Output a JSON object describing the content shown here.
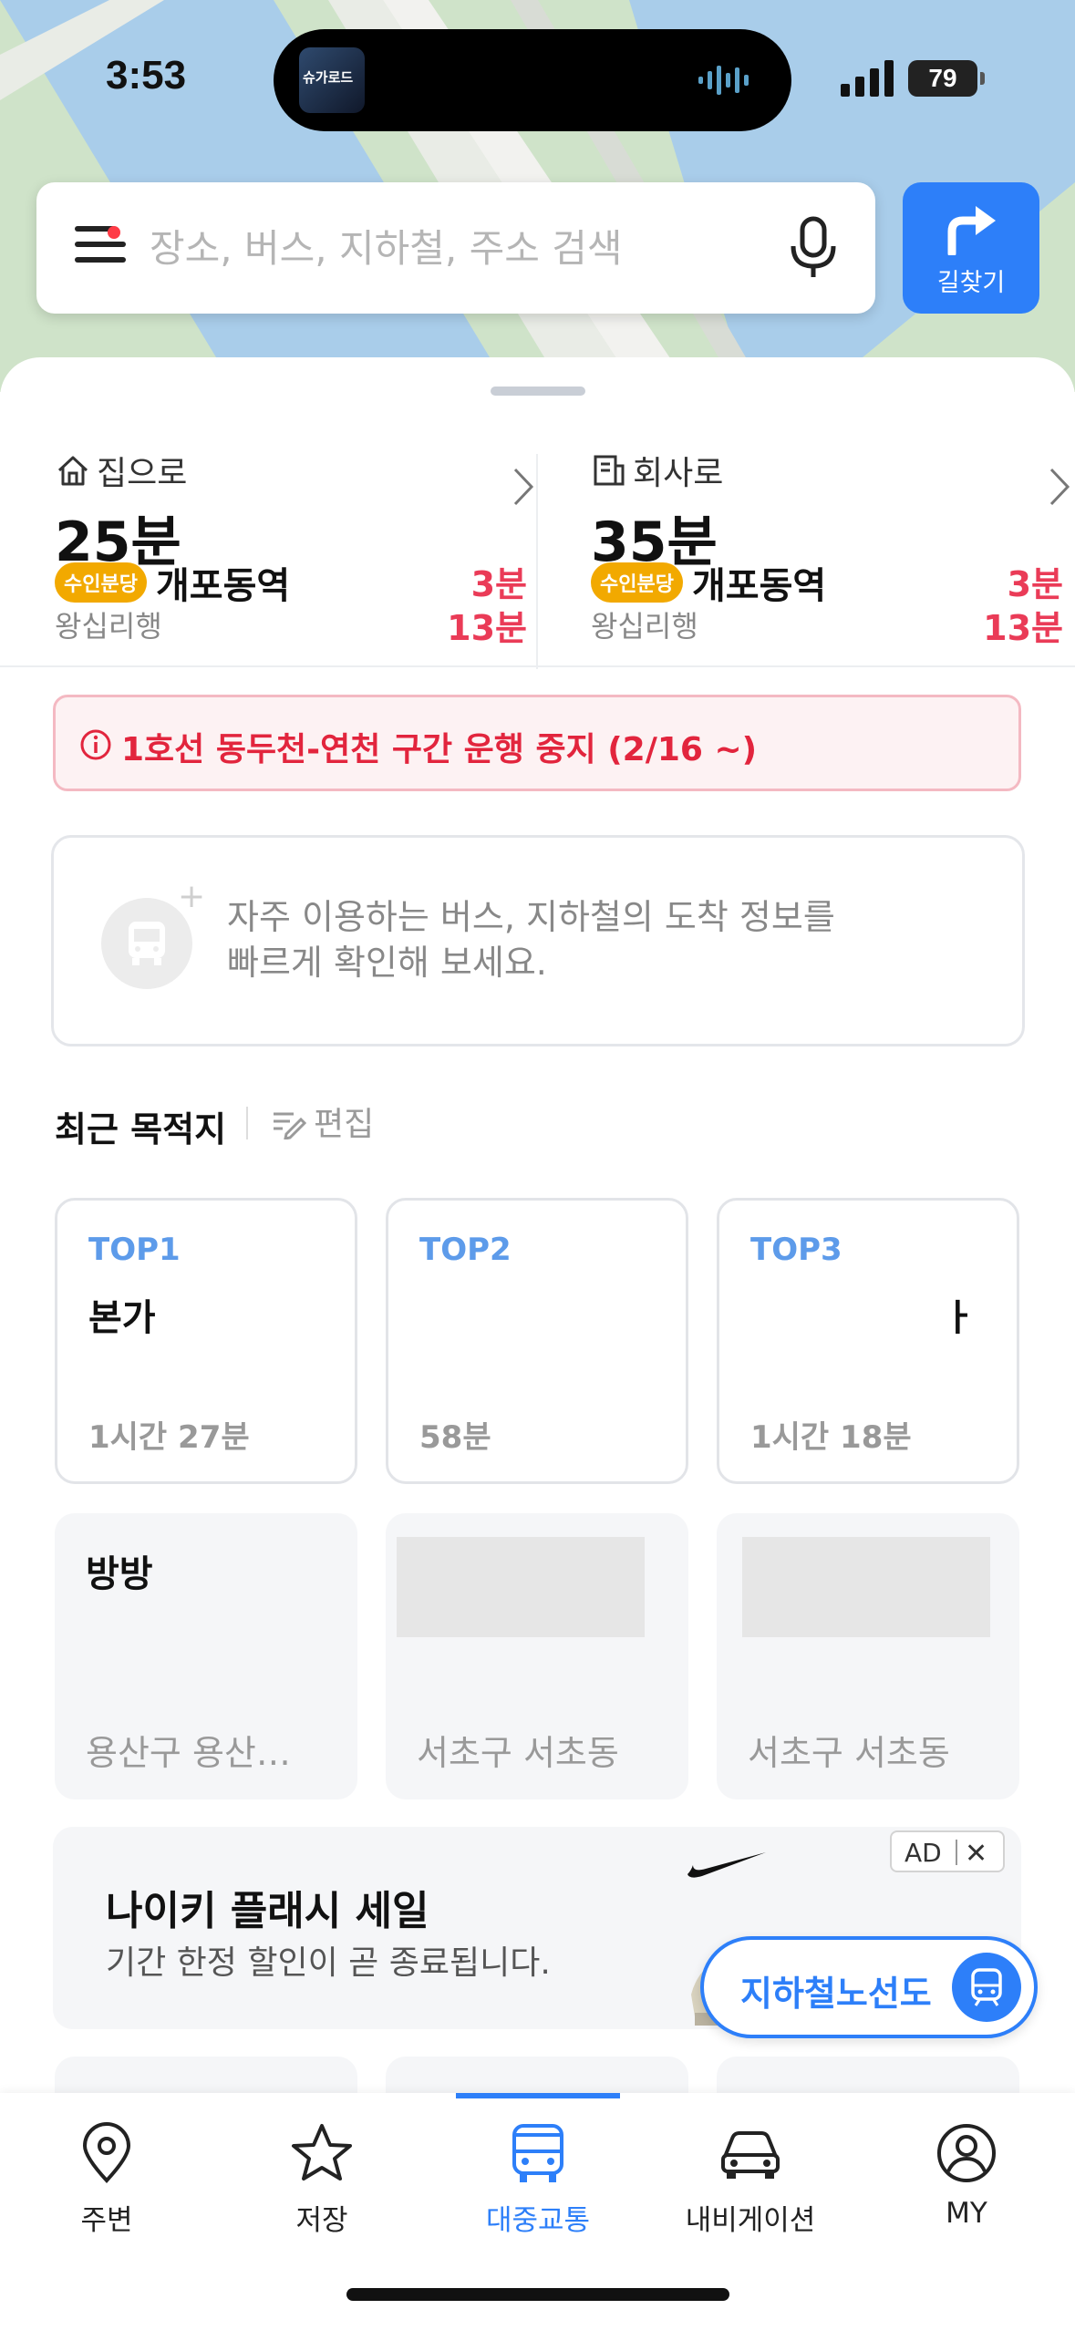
{
  "status_bar": {
    "time": "3:53",
    "battery": "79"
  },
  "search": {
    "placeholder": "장소, 버스, 지하철, 주소 검색"
  },
  "route_button": {
    "label": "길찾기"
  },
  "commute": {
    "home": {
      "label": "집으로",
      "time": "25분",
      "line_badge": "수인분당",
      "station": "개포동역",
      "direction": "왕십리행",
      "arrivals": [
        "3분",
        "13분"
      ]
    },
    "work": {
      "label": "회사로",
      "time": "35분",
      "line_badge": "수인분당",
      "station": "개포동역",
      "direction": "왕십리행",
      "arrivals": [
        "3분",
        "13분"
      ]
    }
  },
  "alert": {
    "text": "1호선 동두천-연천 구간 운행 중지 (2/16 ~)"
  },
  "favorites_prompt": {
    "line1": "자주 이용하는 버스, 지하철의 도착 정보를",
    "line2": "빠르게 확인해 보세요."
  },
  "recent": {
    "title": "최근 목적지",
    "edit_label": "편집",
    "top": [
      {
        "rank": "TOP1",
        "name": "본가",
        "time": "1시간 27분"
      },
      {
        "rank": "TOP2",
        "name": "",
        "time": "58분"
      },
      {
        "rank": "TOP3",
        "name": "ㅏ",
        "time": "1시간 18분"
      }
    ],
    "places": [
      {
        "name": "방방",
        "address": "용산구 용산…"
      },
      {
        "name": "",
        "address": "서초구 서초동"
      },
      {
        "name": "",
        "address": "서초구 서초동"
      }
    ]
  },
  "ad": {
    "tag": "AD",
    "title": "나이키 플래시 세일",
    "subtitle": "기간 한정 할인이 곧 종료됩니다."
  },
  "subway_fab": {
    "label": "지하철노선도"
  },
  "tabs": [
    {
      "label": "주변",
      "icon": "map-pin-icon"
    },
    {
      "label": "저장",
      "icon": "star-icon"
    },
    {
      "label": "대중교통",
      "icon": "bus-icon",
      "active": true
    },
    {
      "label": "내비게이션",
      "icon": "car-icon"
    },
    {
      "label": "MY",
      "icon": "person-icon"
    }
  ],
  "colors": {
    "accent": "#2d7ff9",
    "alert_red": "#e2253d",
    "arrival_red": "#ea3b57",
    "line_yellow": "#f2a900"
  }
}
